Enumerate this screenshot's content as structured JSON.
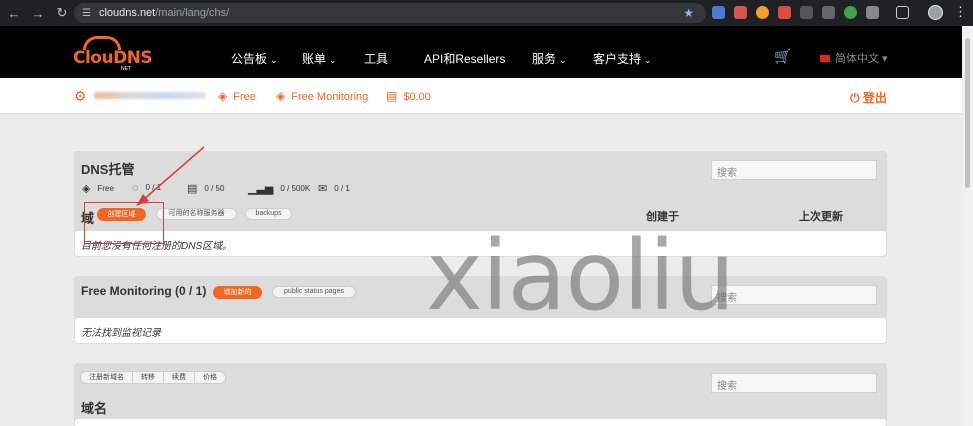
{
  "browser": {
    "url_host": "cloudns.net",
    "url_path": "/main/lang/chs/"
  },
  "logo": {
    "text": "ClouDNS",
    "suffix": "NET"
  },
  "nav": {
    "bulletin": "公告板",
    "account": "账单",
    "tools": "工具",
    "api": "API和Resellers",
    "services": "服务",
    "support": "客户支持",
    "language": "简体中文"
  },
  "account_bar": {
    "plan": "Free",
    "monitoring": "Free Monitoring",
    "balance": "$0.00",
    "logout": "登出"
  },
  "dns_panel": {
    "title": "DNS托管",
    "search_placeholder": "搜索",
    "stats": {
      "plan": "Free",
      "zones": "0 / 1",
      "records": "0 / 50",
      "queries": "0 / 500K",
      "mail_forwards": "0 / 1"
    },
    "zones_label": "域",
    "create_zone_button": "创建区域",
    "available_ns_button": "可用的名称服务器",
    "backups_button": "backups",
    "col_created": "创建于",
    "col_updated": "上次更新",
    "empty_text": "目前您没有任何注册的DNS区域。"
  },
  "monitoring_panel": {
    "title": "Free Monitoring (0 / 1)",
    "add_button": "增加新的",
    "status_pages_button": "public status pages",
    "search_placeholder": "搜索",
    "empty_text": "无法找到监视记录"
  },
  "domains_panel": {
    "tabs": [
      "注册新域名",
      "转移",
      "续费",
      "价格"
    ],
    "search_placeholder": "搜索",
    "title": "域名"
  },
  "watermark": "xiaoliu",
  "colors": {
    "brand_orange": "#f26522",
    "header_black": "#000000",
    "annotation_red": "#e03b3b"
  }
}
